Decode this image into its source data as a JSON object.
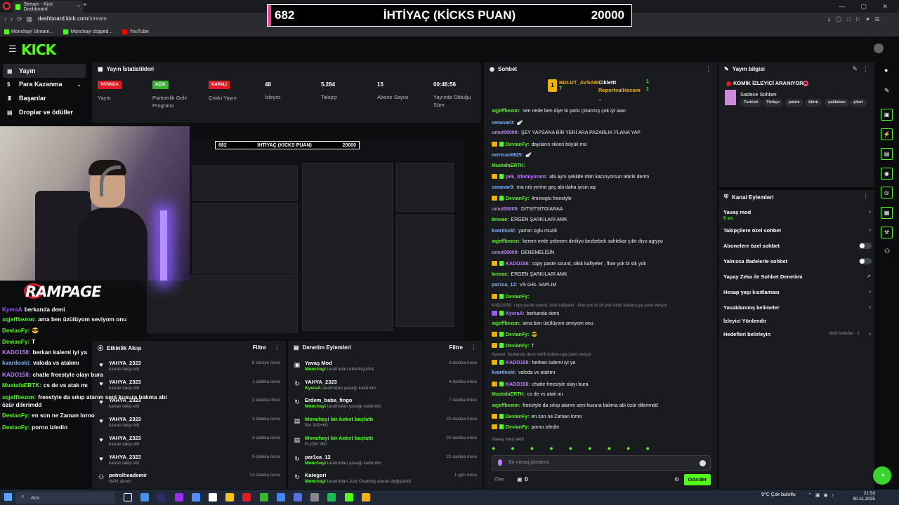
{
  "browser": {
    "tab_title": "Stream - Kick Dashboard",
    "url_domain": "dashboard.kick.com",
    "url_path": "/stream",
    "bookmarks": [
      "Monchayi Stream...",
      "Monchayi clipped...",
      "YouTube"
    ]
  },
  "goal_overlay": {
    "current": "682",
    "title": "İHTİYAÇ (KİCKS PUAN)",
    "target": "20000"
  },
  "kick": {
    "logo": "KICK"
  },
  "nav": {
    "items": [
      {
        "label": "Yayın",
        "icon": "broadcast-icon"
      },
      {
        "label": "Para Kazanma",
        "icon": "dollar-icon"
      },
      {
        "label": "Başarılar",
        "icon": "trophy-icon"
      },
      {
        "label": "Droplar ve ödüller",
        "icon": "gift-icon"
      }
    ]
  },
  "stats": {
    "title": "Yayın İstatistikleri",
    "items": [
      {
        "badge": "YAYINDA",
        "label": "Yayın"
      },
      {
        "badge": "AÇIK",
        "label": "Partnerlik Gelir Programı"
      },
      {
        "badge": "KAPALI",
        "label": "Çoklu Yayın"
      },
      {
        "value": "48",
        "label": "İzleyici"
      },
      {
        "value": "5.284",
        "label": "Takipçi"
      },
      {
        "value": "15",
        "label": "Abone Sayısı"
      },
      {
        "value": "00:46:56",
        "label": "Yayında Olduğu Süre"
      }
    ]
  },
  "overlay": {
    "brand": "RAMPAGE",
    "chat": [
      {
        "user": "KyeraA",
        "text": "berkanda demi",
        "color": "#9b59ff"
      },
      {
        "user": "xqjeffbezon:",
        "text": "ama ben üzülüyom seviyom onu",
        "color": "#53fc18"
      },
      {
        "user": "DevianFy:",
        "text": "😎",
        "color": "#53fc18"
      },
      {
        "user": "DevianFy:",
        "text": "T",
        "color": "#53fc18"
      },
      {
        "user": "KADO158:",
        "text": "berkan kalemi iyi ya",
        "color": "#c07cff"
      },
      {
        "user": "kvardoski:",
        "text": "valoda vs atakmı",
        "color": "#7fb3ff"
      },
      {
        "user": "KADO158:",
        "text": "chatle freestyle olayı bura",
        "color": "#c07cff"
      },
      {
        "user": "MustafaERTK:",
        "text": "cs de vs atak mı",
        "color": "#53fc18"
      },
      {
        "user": "xqjeffbezon:",
        "text": "freestyle da sıkıp atarım seni kusura bakma abi özür dilerimdd",
        "color": "#53fc18"
      },
      {
        "user": "DevianFy:",
        "text": "en son ne Zaman lorno",
        "color": "#53fc18"
      },
      {
        "user": "DevianFy:",
        "text": "porno izledin",
        "color": "#53fc18"
      }
    ]
  },
  "feed": {
    "title": "Etkinlik Akışı",
    "filter": "Filtre",
    "rows": [
      {
        "name": "YAHYA_2323",
        "sub": "kanalı takip etti",
        "time": "8 saniye önce",
        "icon": "heart-icon"
      },
      {
        "name": "YAHYA_2323",
        "sub": "kanalı takip etti",
        "time": "1 dakika önce",
        "icon": "heart-icon"
      },
      {
        "name": "YAHYA_2323",
        "sub": "kanalı takip etti",
        "time": "3 dakika önce",
        "icon": "heart-icon"
      },
      {
        "name": "YAHYA_2323",
        "sub": "kanalı takip etti",
        "time": "3 dakika önce",
        "icon": "heart-icon"
      },
      {
        "name": "YAHYA_2323",
        "sub": "kanalı takip etti",
        "time": "3 dakika önce",
        "icon": "heart-icon"
      },
      {
        "name": "YAHYA_2323",
        "sub": "kanalı takip etti",
        "time": "9 dakika önce",
        "icon": "heart-icon"
      },
      {
        "name": "petrolheademir",
        "sub": "NAH alındı",
        "time": "13 dakika önce",
        "icon": "points-icon"
      }
    ]
  },
  "mod": {
    "title": "Denetim Eylemleri",
    "filter": "Filtre",
    "rows": [
      {
        "name": "Yavaş Mod",
        "actor": "Monchayi",
        "sub": "tarafından etkinleştirildi",
        "time": "3 dakika önce",
        "icon": "slow-icon"
      },
      {
        "name": "YAHYA_2323",
        "actor": "KyeraA",
        "sub": "tarafından yasağı kaldırıldı",
        "time": "4 dakika önce",
        "icon": "unban-icon"
      },
      {
        "name": "Erdem_baba_fingo",
        "actor": "Monchayi",
        "sub": "tarafından yasağı kaldırıldı",
        "time": "7 dakika önce",
        "icon": "unban-icon"
      },
      {
        "name": "Monchayi bir Anket başlattı",
        "actor": "",
        "sub": "flor 300+60",
        "time": "20 dakika önce",
        "icon": "poll-icon"
      },
      {
        "name": "Monchayi bir Anket başlattı",
        "actor": "",
        "sub": "FLOW 360",
        "time": "20 dakika önce",
        "icon": "poll-icon"
      },
      {
        "name": "par1ca_12",
        "actor": "Monchayi",
        "sub": "tarafından yasağı kaldırıldı",
        "time": "22 dakika önce",
        "icon": "unban-icon"
      },
      {
        "name": "Kategori",
        "actor": "Monchayi",
        "sub": "tarafından Just Chatting olarak değiştirildi",
        "time": "1 gün önce",
        "icon": "category-icon"
      }
    ]
  },
  "chat": {
    "title": "Sohbet",
    "pinned": [
      {
        "user": "BULUT_AVSAR",
        "value": "7"
      },
      {
        "user": "Ciklettt",
        "value": "1"
      },
      {
        "user": "ReportsalHocam",
        "value": "1"
      }
    ],
    "messages": [
      {
        "user": "xqjeffbezon:",
        "text": "sen nede ben diye bi şarkı çıkarmış çok iyi laan",
        "color": "#53fc18",
        "badge": ""
      },
      {
        "user": "cenavar0:",
        "text": "🪽",
        "color": "#7fb3ff",
        "badge": ""
      },
      {
        "user": "umut00009:",
        "text": "ŞEY YAPSANA BİR YERİ ARA PAZARLIK FLANA YAP",
        "color": "#c07cff",
        "badge": ""
      },
      {
        "user": "DevianFy:",
        "text": "dayıların sikleri büyük mü",
        "color": "#53fc18",
        "badge": "Y"
      },
      {
        "user": "mertcan0625:",
        "text": "🪽",
        "color": "#7fb3ff",
        "badge": ""
      },
      {
        "user": "MustafaERTK:",
        "text": "",
        "color": "#53fc18",
        "badge": ""
      },
      {
        "user": "pek_izlemiyorum:",
        "text": "abi aynı şekilde ritim kacırıyorsun tebrik derim",
        "color": "#c07cff",
        "badge": "Y"
      },
      {
        "user": "cenavar0:",
        "text": "era nıb yerine geç abi daha iyisin aq",
        "color": "#7fb3ff",
        "badge": ""
      },
      {
        "user": "DevianFy:",
        "text": "4mınoglu freestyle",
        "color": "#53fc18",
        "badge": "Y"
      },
      {
        "user": "umut00009:",
        "text": "DİTSİTSİTGİARAA",
        "color": "#c07cff",
        "badge": ""
      },
      {
        "user": "krexae:",
        "text": "ERGEN ŞARKILARI AMK",
        "color": "#53fc18",
        "badge": ""
      },
      {
        "user": "kvardoski:",
        "text": "yarran oglu muzik",
        "color": "#7fb3ff",
        "badge": ""
      },
      {
        "user": "xqjeffbezon:",
        "text": "kerem evde şebnem diniliyo bezbebek sahtekar çıktı diyo agiyyo",
        "color": "#53fc18",
        "badge": ""
      },
      {
        "user": "umut00009:",
        "text": "DENEMELİSİN",
        "color": "#c07cff",
        "badge": ""
      },
      {
        "user": "KADO158:",
        "text": "copy paste sound, sikik kafiyeler , flow yok bi sik yok",
        "color": "#c07cff",
        "badge": "Y"
      },
      {
        "user": "krexae:",
        "text": "ERGEN ŞARKILARI AMK",
        "color": "#53fc18",
        "badge": ""
      },
      {
        "user": "par1ca_12:",
        "text": "VS GEL SAPLIM",
        "color": "#7fb3ff",
        "badge": ""
      },
      {
        "user": "DevianFy:",
        "text": "",
        "color": "#53fc18",
        "badge": "Y"
      },
      {
        "user": "KADO158:",
        "text": "copy paste sound, sikik kafiyeler , flow yok bi sik yok isimli kullanıcıya yanıt veriyor",
        "color": "#8b8b8b",
        "badge": ""
      },
      {
        "user": "KyeraA:",
        "text": "berkanda demi",
        "color": "#c07cff",
        "badge": "P"
      },
      {
        "user": "xqjeffbezon:",
        "text": "ama ben üzülüyom seviyom onu",
        "color": "#53fc18",
        "badge": ""
      },
      {
        "user": "DevianFy:",
        "text": "😎",
        "color": "#53fc18",
        "badge": "Y"
      },
      {
        "user": "DevianFy:",
        "text": "T",
        "color": "#53fc18",
        "badge": "Y"
      },
      {
        "user": "KyeraA: berkanda demi isimli kullanıcıya yanıt veriyor",
        "text": "",
        "color": "#8b8b8b",
        "badge": ""
      },
      {
        "user": "KADO158:",
        "text": "berkan kalemi iyi ya",
        "color": "#c07cff",
        "badge": "Y"
      },
      {
        "user": "kvardoski:",
        "text": "valoda vs atakmı",
        "color": "#7fb3ff",
        "badge": ""
      },
      {
        "user": "KADO158:",
        "text": "chatle freestyle olayı bura",
        "color": "#c07cff",
        "badge": "Y"
      },
      {
        "user": "MustafaERTK:",
        "text": "cs de vs atak mı",
        "color": "#53fc18",
        "badge": ""
      },
      {
        "user": "xqjeffbezon:",
        "text": "freestyle da sıkıp atarım seni kusura bakma abi özür dilerimdd",
        "color": "#53fc18",
        "badge": ""
      },
      {
        "user": "DevianFy:",
        "text": "en son ne Zaman lorno",
        "color": "#53fc18",
        "badge": "Y"
      },
      {
        "user": "DevianFy:",
        "text": "porno izledin",
        "color": "#53fc18",
        "badge": "Y"
      }
    ],
    "slow_mode_notice": "Yavaş mod aktif",
    "placeholder": "Bir mesaj gönderin",
    "points": "0",
    "send_label": "Gönder"
  },
  "stream_info": {
    "title": "Yayın bilgisi",
    "stream_title": "KOMİK İZLEYİCİ ARANIYOR..",
    "category": "Sadece Sohbet",
    "tags": [
      "Turkish",
      "Türkçe",
      "patris",
      "tikirtı",
      "şaklaban",
      "şikırt"
    ]
  },
  "channel_actions": {
    "title": "Kanal Eylemleri",
    "items": [
      {
        "label": "Yavaş mod",
        "sub": "5 sn.",
        "control": "chevron"
      },
      {
        "label": "Takipçilere özel sohbet",
        "control": "chevron"
      },
      {
        "label": "Abonelere özel sohbet",
        "control": "toggle"
      },
      {
        "label": "Yalnızca ifadelerle sohbet",
        "control": "toggle"
      },
      {
        "label": "Yapay Zeka ile Sohbet Denetimi",
        "control": "external"
      },
      {
        "label": "Hesap yaşı kısıtlaması",
        "control": "chevron"
      },
      {
        "label": "Yasaklanmış kelimeler",
        "control": "chevron"
      },
      {
        "label": "İzleyici Yönlendir",
        "control": "none"
      },
      {
        "label": "Hedefleri belirleyin",
        "control": "chevron",
        "status": "Aktif hedefler - 1"
      }
    ]
  },
  "taskbar": {
    "search_placeholder": "Ara",
    "weather": "9°C  Çok bulutlu",
    "time": "21:53",
    "date": "30.11.2025"
  },
  "colors": {
    "accent": "#53fc18",
    "live_red": "#e01b24",
    "panel_bg": "#191b1f",
    "goal_fill": "#ff3aa0"
  }
}
